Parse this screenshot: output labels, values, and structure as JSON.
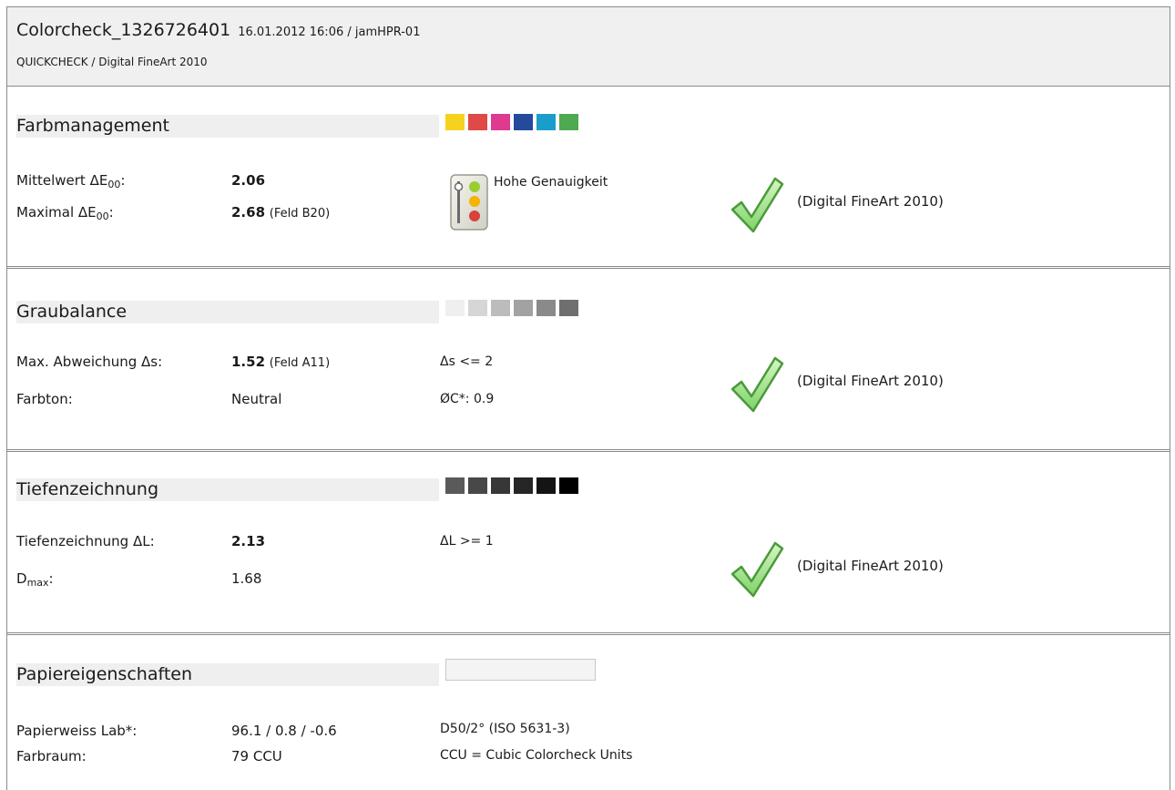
{
  "header": {
    "title": "Colorcheck_1326726401",
    "meta": "16.01.2012 16:06 / jamHPR-01",
    "subtitle": "QUICKCHECK / Digital FineArt 2010"
  },
  "farbmanagement": {
    "title": "Farbmanagement",
    "swatch_colors": [
      "#f5d21e",
      "#e04a46",
      "#de3a90",
      "#244a9b",
      "#1b9dcc",
      "#4ea951"
    ],
    "mittelwert_label": "Mittelwert ΔE",
    "mittelwert_sub": "00",
    "mittelwert_value": "2.06",
    "maximal_label": "Maximal ΔE",
    "maximal_sub": "00",
    "maximal_value": "2.68",
    "maximal_note": "(Feld B20)",
    "accuracy_text": "Hohe Genauigkeit",
    "verdict": "(Digital FineArt 2010)",
    "traffic_light_icon": "traffic-light-icon",
    "check_icon": "green-checkmark-icon"
  },
  "graubalance": {
    "title": "Graubalance",
    "swatch_colors": [
      "#efefef",
      "#d6d6d6",
      "#bcbcbc",
      "#a2a2a2",
      "#8a8a8a",
      "#6f6f6f"
    ],
    "max_label": "Max. Abweichung Δs:",
    "max_value": "1.52",
    "max_note": "(Feld A11)",
    "max_criterion": "Δs <= 2",
    "farbton_label": "Farbton:",
    "farbton_value": "Neutral",
    "farbton_criterion": "ØC*: 0.9",
    "verdict": "(Digital FineArt 2010)",
    "check_icon": "green-checkmark-icon"
  },
  "tiefenzeichnung": {
    "title": "Tiefenzeichnung",
    "swatch_colors": [
      "#5a5a5a",
      "#484848",
      "#373737",
      "#262626",
      "#141414",
      "#000000"
    ],
    "tz_label": "Tiefenzeichnung ΔL:",
    "tz_value": "2.13",
    "tz_criterion": "ΔL >= 1",
    "dmax_label": "D",
    "dmax_sub": "max",
    "dmax_value": "1.68",
    "verdict": "(Digital FineArt 2010)",
    "check_icon": "green-checkmark-icon"
  },
  "papier": {
    "title": "Papiereigenschaften",
    "weiss_label": "Papierweiss Lab*:",
    "weiss_value": "96.1 / 0.8 / -0.6",
    "weiss_note": "D50/2° (ISO 5631-3)",
    "farbraum_label": "Farbraum:",
    "farbraum_value": "79 CCU",
    "farbraum_note": "CCU = Cubic Colorcheck Units"
  }
}
